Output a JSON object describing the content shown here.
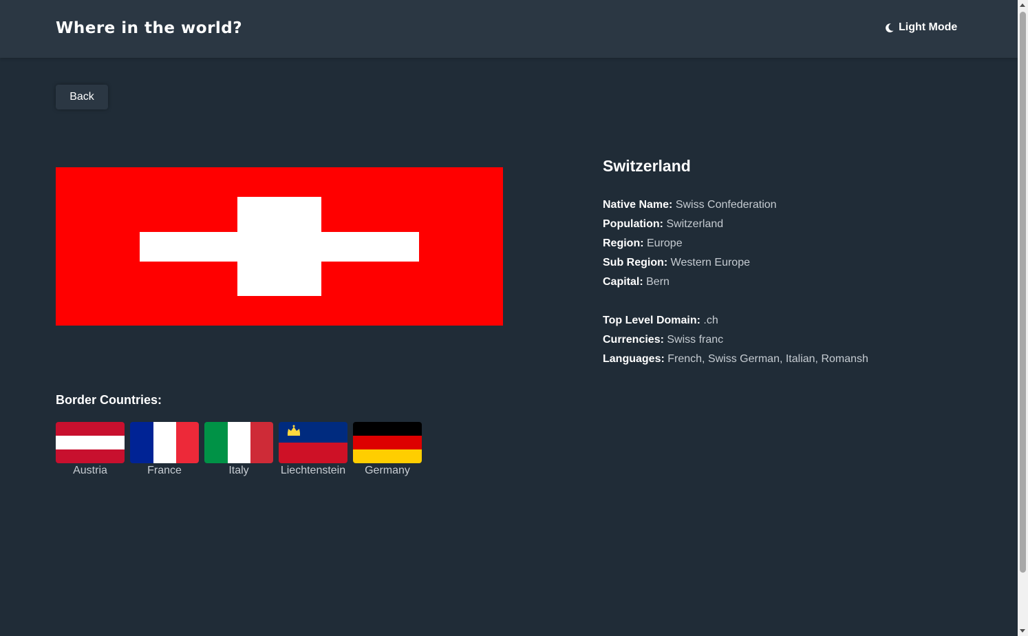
{
  "header": {
    "title": "Where in the world?",
    "mode_toggle": {
      "icon": "moon-icon",
      "label": "Light Mode"
    }
  },
  "back_button": {
    "label": "Back"
  },
  "country": {
    "name": "Switzerland",
    "flag_icon": "switzerland-flag",
    "details_primary": [
      {
        "label": "Native Name:",
        "value": "Swiss Confederation"
      },
      {
        "label": "Population:",
        "value": "Switzerland"
      },
      {
        "label": "Region:",
        "value": "Europe"
      },
      {
        "label": "Sub Region:",
        "value": "Western Europe"
      },
      {
        "label": "Capital:",
        "value": "Bern"
      }
    ],
    "details_secondary": [
      {
        "label": "Top Level Domain:",
        "value": ".ch"
      },
      {
        "label": "Currencies:",
        "value": "Swiss franc"
      },
      {
        "label": "Languages:",
        "value": "French, Swiss German, Italian, Romansh"
      }
    ]
  },
  "border_section": {
    "title": "Border Countries:",
    "countries": [
      {
        "name": "Austria",
        "flag_icon": "austria-flag"
      },
      {
        "name": "France",
        "flag_icon": "france-flag"
      },
      {
        "name": "Italy",
        "flag_icon": "italy-flag"
      },
      {
        "name": "Liechtenstein",
        "flag_icon": "liechtenstein-flag"
      },
      {
        "name": "Germany",
        "flag_icon": "germany-flag"
      }
    ]
  },
  "colors": {
    "background": "#202c37",
    "elements": "#2b3743",
    "text": "#ffffff",
    "muted_text": "#c6ccd2",
    "swiss_red": "#ff0000"
  }
}
